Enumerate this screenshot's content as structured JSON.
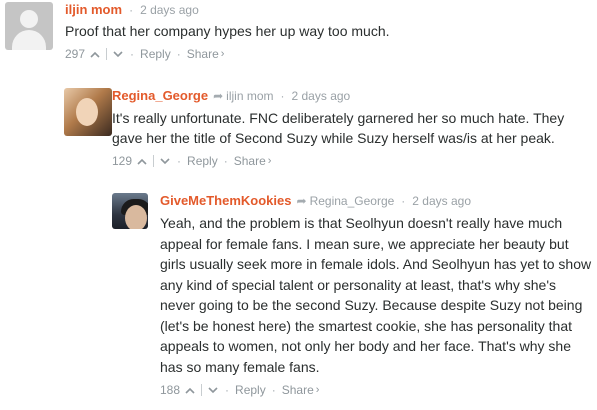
{
  "comments": [
    {
      "author": "iljin mom",
      "reply_to": "",
      "timestamp": "2 days ago",
      "text": "Proof that her company hypes her up way too much.",
      "votes": "297",
      "reply_label": "Reply",
      "share_label": "Share",
      "share_chevron": "›"
    },
    {
      "author": "Regina_George",
      "reply_to": "iljin mom",
      "timestamp": "2 days ago",
      "text": "It's really unfortunate. FNC deliberately garnered her so much hate. They gave her the title of Second Suzy while Suzy herself was/is at her peak.",
      "votes": "129",
      "reply_label": "Reply",
      "share_label": "Share",
      "share_chevron": "›"
    },
    {
      "author": "GiveMeThemKookies",
      "reply_to": "Regina_George",
      "timestamp": "2 days ago",
      "text": "Yeah, and the problem is that Seolhyun doesn't really have much appeal for female fans. I mean sure, we appreciate her beauty but girls usually seek more in female idols. And Seolhyun has yet to show any kind of special talent or personality at least, that's why she's never going to be the second Suzy. Because despite Suzy not being (let's be honest here) the smartest cookie, she has personality that appeals to women, not only her body and her face. That's why she has so many female fans.",
      "votes": "188",
      "reply_label": "Reply",
      "share_label": "Share",
      "share_chevron": "›"
    }
  ],
  "icons": {
    "reply_arrow": "reply-arrow-icon",
    "upvote": "chevron-up-icon",
    "downvote": "chevron-down-icon"
  },
  "colors": {
    "author": "#e35a2b",
    "meta": "#9aa1a6",
    "text": "#2a2e2e"
  },
  "separators": {
    "bullet": "·"
  }
}
